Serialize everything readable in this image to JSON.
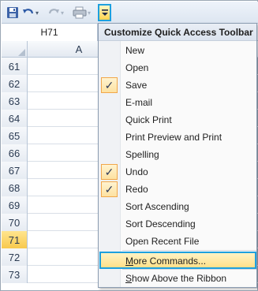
{
  "toolbar": {
    "save_icon": "save-icon",
    "undo_icon": "undo-icon",
    "redo_icon": "redo-icon",
    "print_icon": "quick-print-icon",
    "customize_icon": "customize-toolbar-icon"
  },
  "namebox": {
    "value": "H71"
  },
  "column_header": {
    "label": "A"
  },
  "rows": [
    {
      "num": "61"
    },
    {
      "num": "62"
    },
    {
      "num": "63"
    },
    {
      "num": "64"
    },
    {
      "num": "65"
    },
    {
      "num": "66"
    },
    {
      "num": "67"
    },
    {
      "num": "68"
    },
    {
      "num": "69"
    },
    {
      "num": "70"
    },
    {
      "num": "71"
    },
    {
      "num": "72"
    },
    {
      "num": "73"
    }
  ],
  "menu": {
    "title": "Customize Quick Access Toolbar",
    "items": [
      {
        "label": "New",
        "checked": false
      },
      {
        "label": "Open",
        "checked": false
      },
      {
        "label": "Save",
        "checked": true
      },
      {
        "label": "E-mail",
        "checked": false
      },
      {
        "label": "Quick Print",
        "checked": false
      },
      {
        "label": "Print Preview and Print",
        "checked": false
      },
      {
        "label": "Spelling",
        "checked": false
      },
      {
        "label": "Undo",
        "checked": true
      },
      {
        "label": "Redo",
        "checked": true
      },
      {
        "label": "Sort Ascending",
        "checked": false
      },
      {
        "label": "Sort Descending",
        "checked": false
      },
      {
        "label": "Open Recent File",
        "checked": false
      }
    ],
    "more_commands": "More Commands...",
    "more_commands_key": "M",
    "more_commands_rest": "ore Commands...",
    "show_above": "Show Above the Ribbon",
    "show_above_key": "S",
    "show_above_rest": "how Above the Ribbon",
    "check_glyph": "✓"
  },
  "colors": {
    "highlight_border": "#1ea0de",
    "active_row": "#f8c94c",
    "check_border": "#f1a74a"
  }
}
